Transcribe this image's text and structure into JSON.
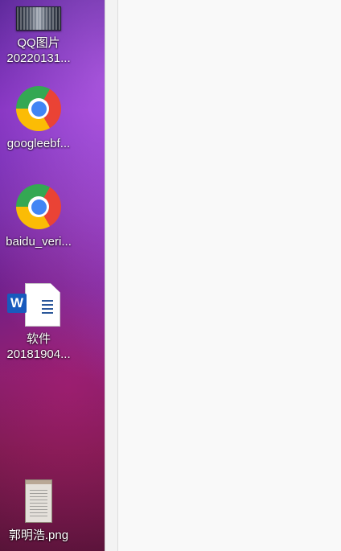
{
  "desktop": {
    "icons": [
      {
        "id": "qq",
        "label_line1": "QQ图片",
        "label_line2": "20220131...",
        "icon": "image-thumbnail-icon"
      },
      {
        "id": "chrome1",
        "label_line1": "googleebf...",
        "icon": "chrome-icon"
      },
      {
        "id": "chrome2",
        "label_line1": "baidu_veri...",
        "icon": "chrome-icon"
      },
      {
        "id": "word",
        "label_line1": "软件",
        "label_line2": "20181904...",
        "icon": "word-document-icon",
        "badge": "W"
      },
      {
        "id": "png",
        "label_line1": "郭明浩.png",
        "icon": "image-thumbnail-icon"
      }
    ]
  },
  "colors": {
    "word_blue": "#185abd",
    "window_bg": "#f9f9f9"
  }
}
